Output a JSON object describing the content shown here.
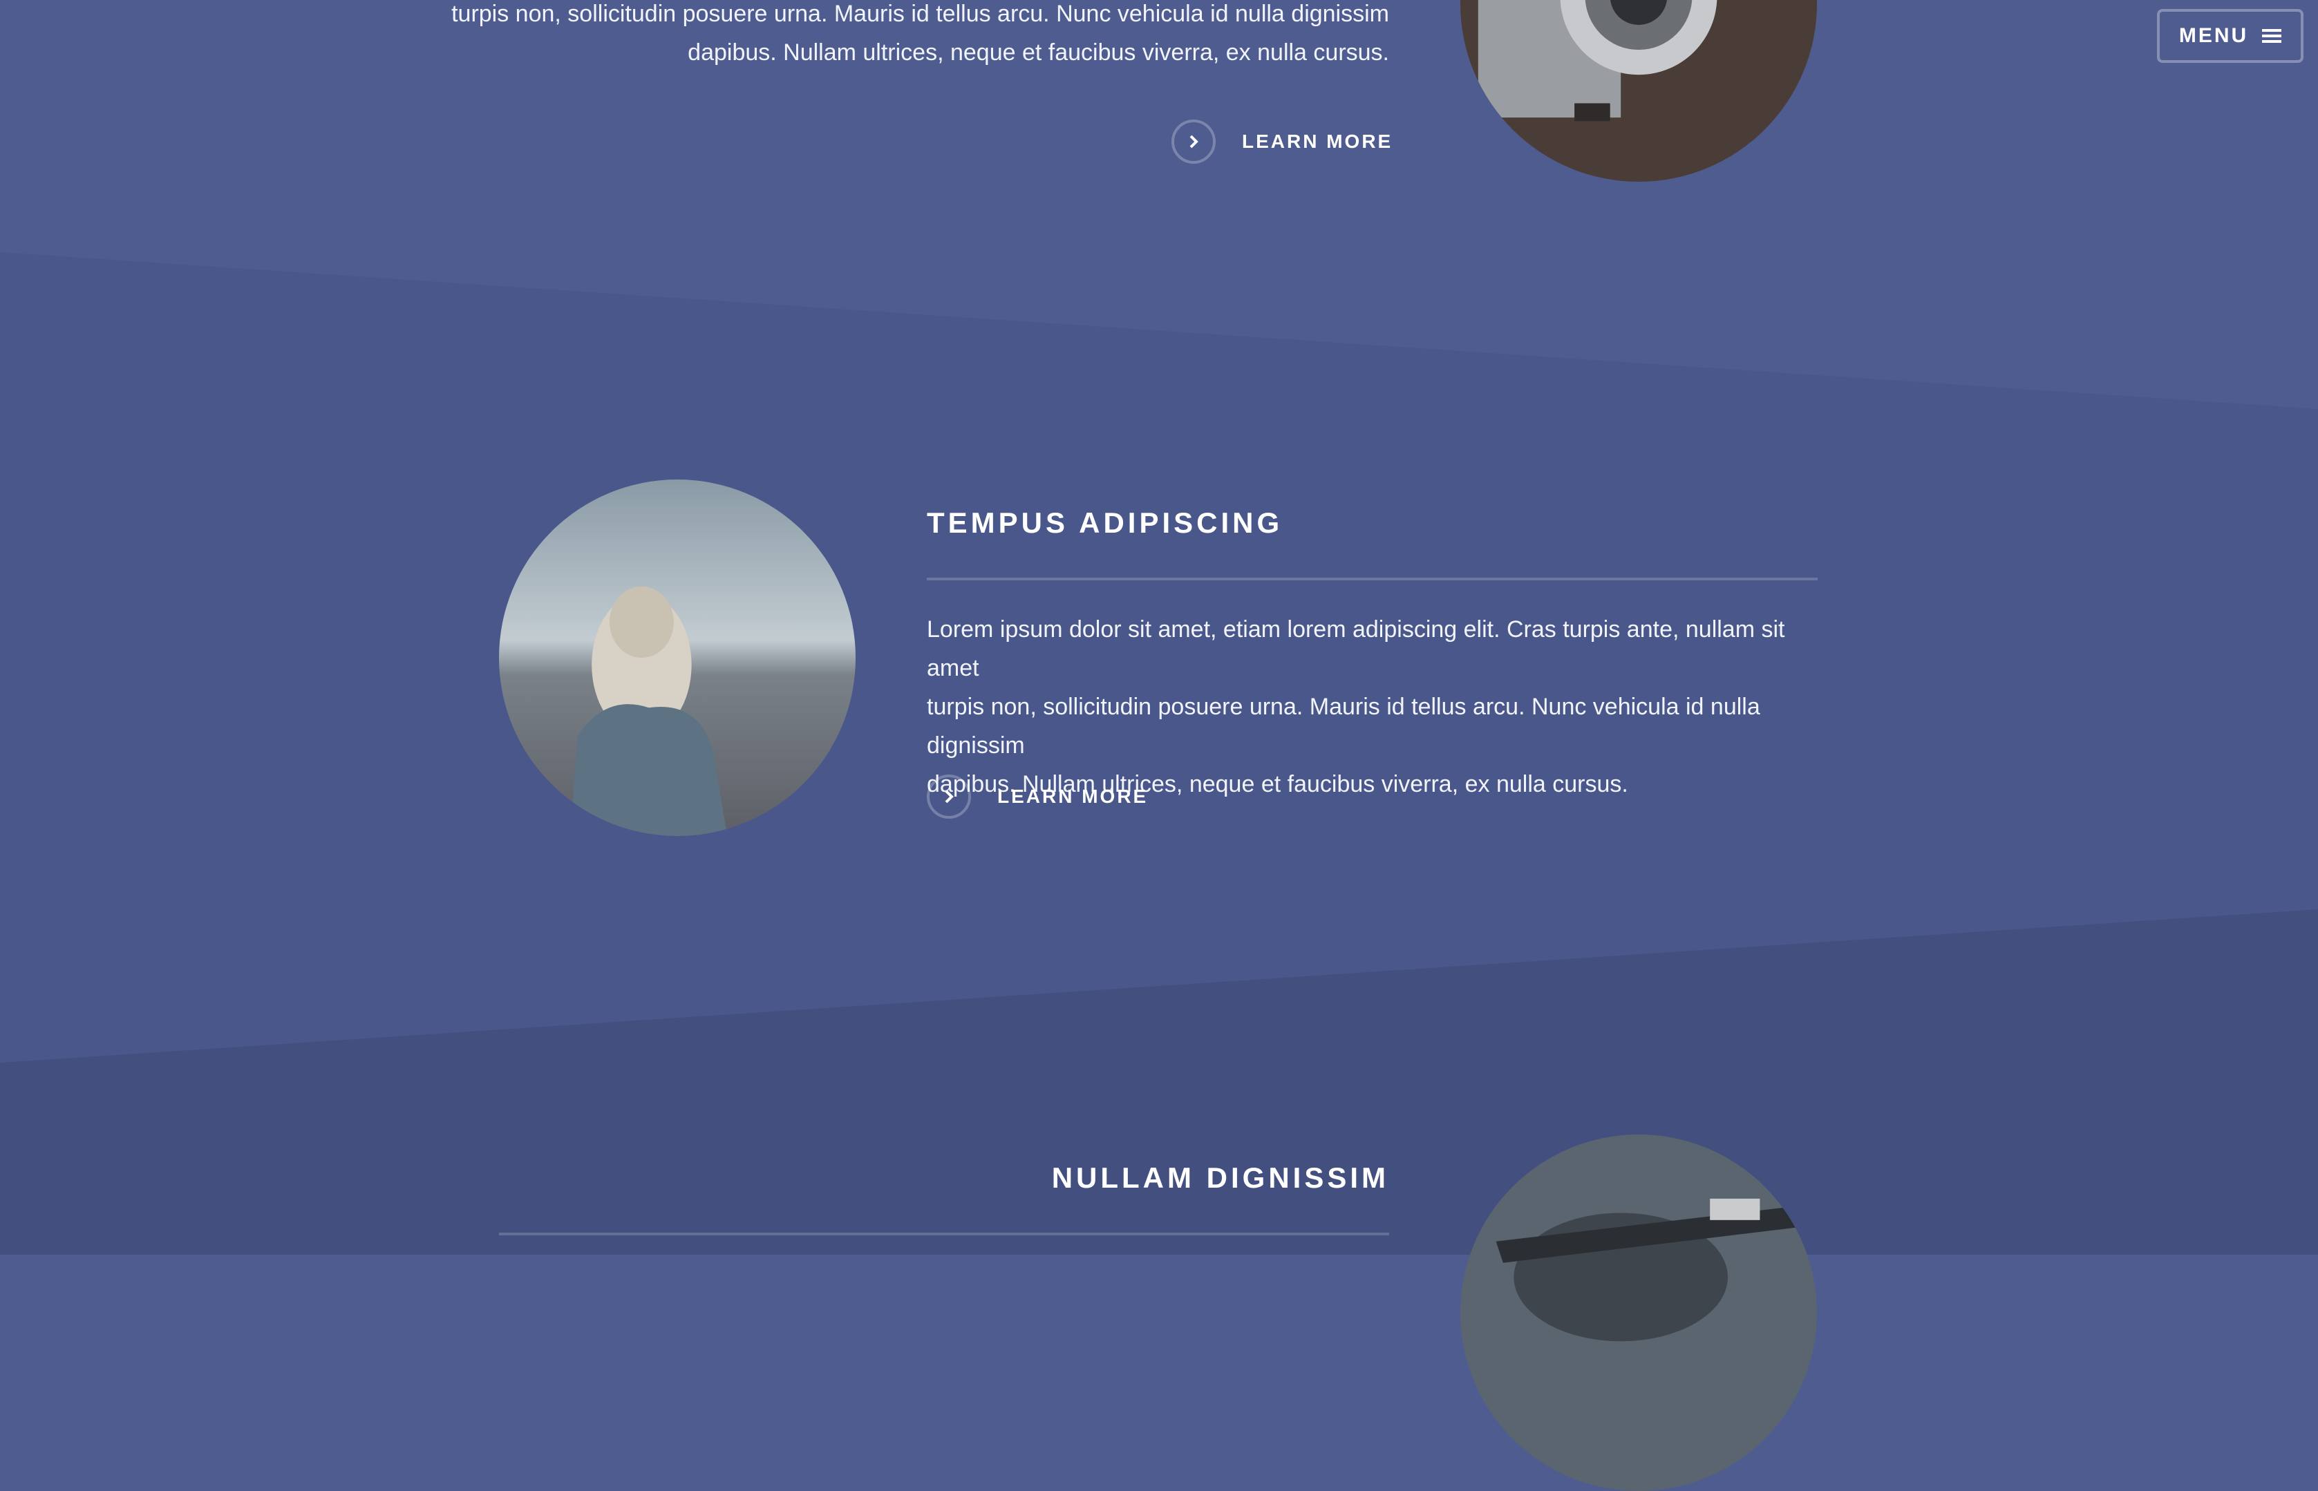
{
  "nav": {
    "menu_label": "MENU"
  },
  "sections": [
    {
      "heading": "",
      "text_lines": [
        "turpis non, sollicitudin posuere urna. Mauris id tellus arcu. Nunc vehicula id nulla dignissim",
        "dapibus. Nullam ultrices, neque et faucibus viverra, ex nulla cursus."
      ],
      "link_label": "LEARN MORE",
      "image": "camera-photo"
    },
    {
      "heading": "TEMPUS ADIPISCING",
      "text_lines": [
        "Lorem ipsum dolor sit amet, etiam lorem adipiscing elit. Cras turpis ante, nullam sit amet",
        "turpis non, sollicitudin posuere urna. Mauris id tellus arcu. Nunc vehicula id nulla dignissim",
        "dapibus. Nullam ultrices, neque et faucibus viverra, ex nulla cursus."
      ],
      "link_label": "LEARN MORE",
      "image": "woman-landscape-photo"
    },
    {
      "heading": "NULLAM DIGNISSIM",
      "image": "bicycle-photo"
    }
  ],
  "colors": {
    "band_1": "#4f5c90",
    "band_2": "#4a578b",
    "band_3": "#43507f"
  },
  "icons": [
    "hamburger-icon",
    "chevron-right-icon"
  ]
}
